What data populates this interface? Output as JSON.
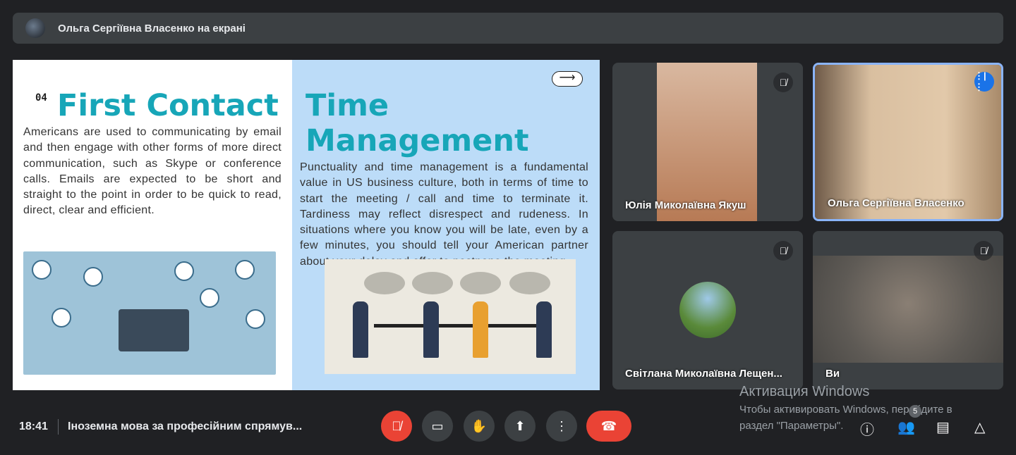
{
  "topbar": {
    "presenting": "Ольга Сергіївна Власенко на екрані"
  },
  "slide": {
    "number": "04",
    "left_title": "First Contact",
    "left_body": "Americans are used to communicating by email and then engage with other forms of more direct communication, such as Skype or conference calls. Emails are expected to be short and straight to the point in order to be quick to read, direct, clear and efficient.",
    "right_title": "Time Management",
    "right_body": "Punctuality and time management is a fundamental value in US business culture, both in terms of time to start the meeting / call and time to terminate it. Tardiness may reflect disrespect and rudeness. In situations where you know you will be late, even by a few minutes, you should tell your American partner about your delay and offer to postpone the meeting.",
    "next_arrow": "⟶"
  },
  "participants": [
    {
      "name": "Юлія Миколаївна Якуш",
      "muted": true
    },
    {
      "name": "Ольга Сергіївна Власенко",
      "speaking": true
    },
    {
      "name": "Світлана Миколаївна Лещен...",
      "muted": true
    },
    {
      "name": "Ви",
      "muted": true
    }
  ],
  "bottom": {
    "time": "18:41",
    "meeting_title": "Іноземна мова за професійним спрямув...",
    "participant_count": "5"
  },
  "watermark": {
    "title": "Активация Windows",
    "line1": "Чтобы активировать Windows, перейдите в",
    "line2": "раздел \"Параметры\"."
  },
  "colors": {
    "accent": "#1aa7b8",
    "end_call": "#ea4335",
    "speaking": "#1a73e8"
  }
}
